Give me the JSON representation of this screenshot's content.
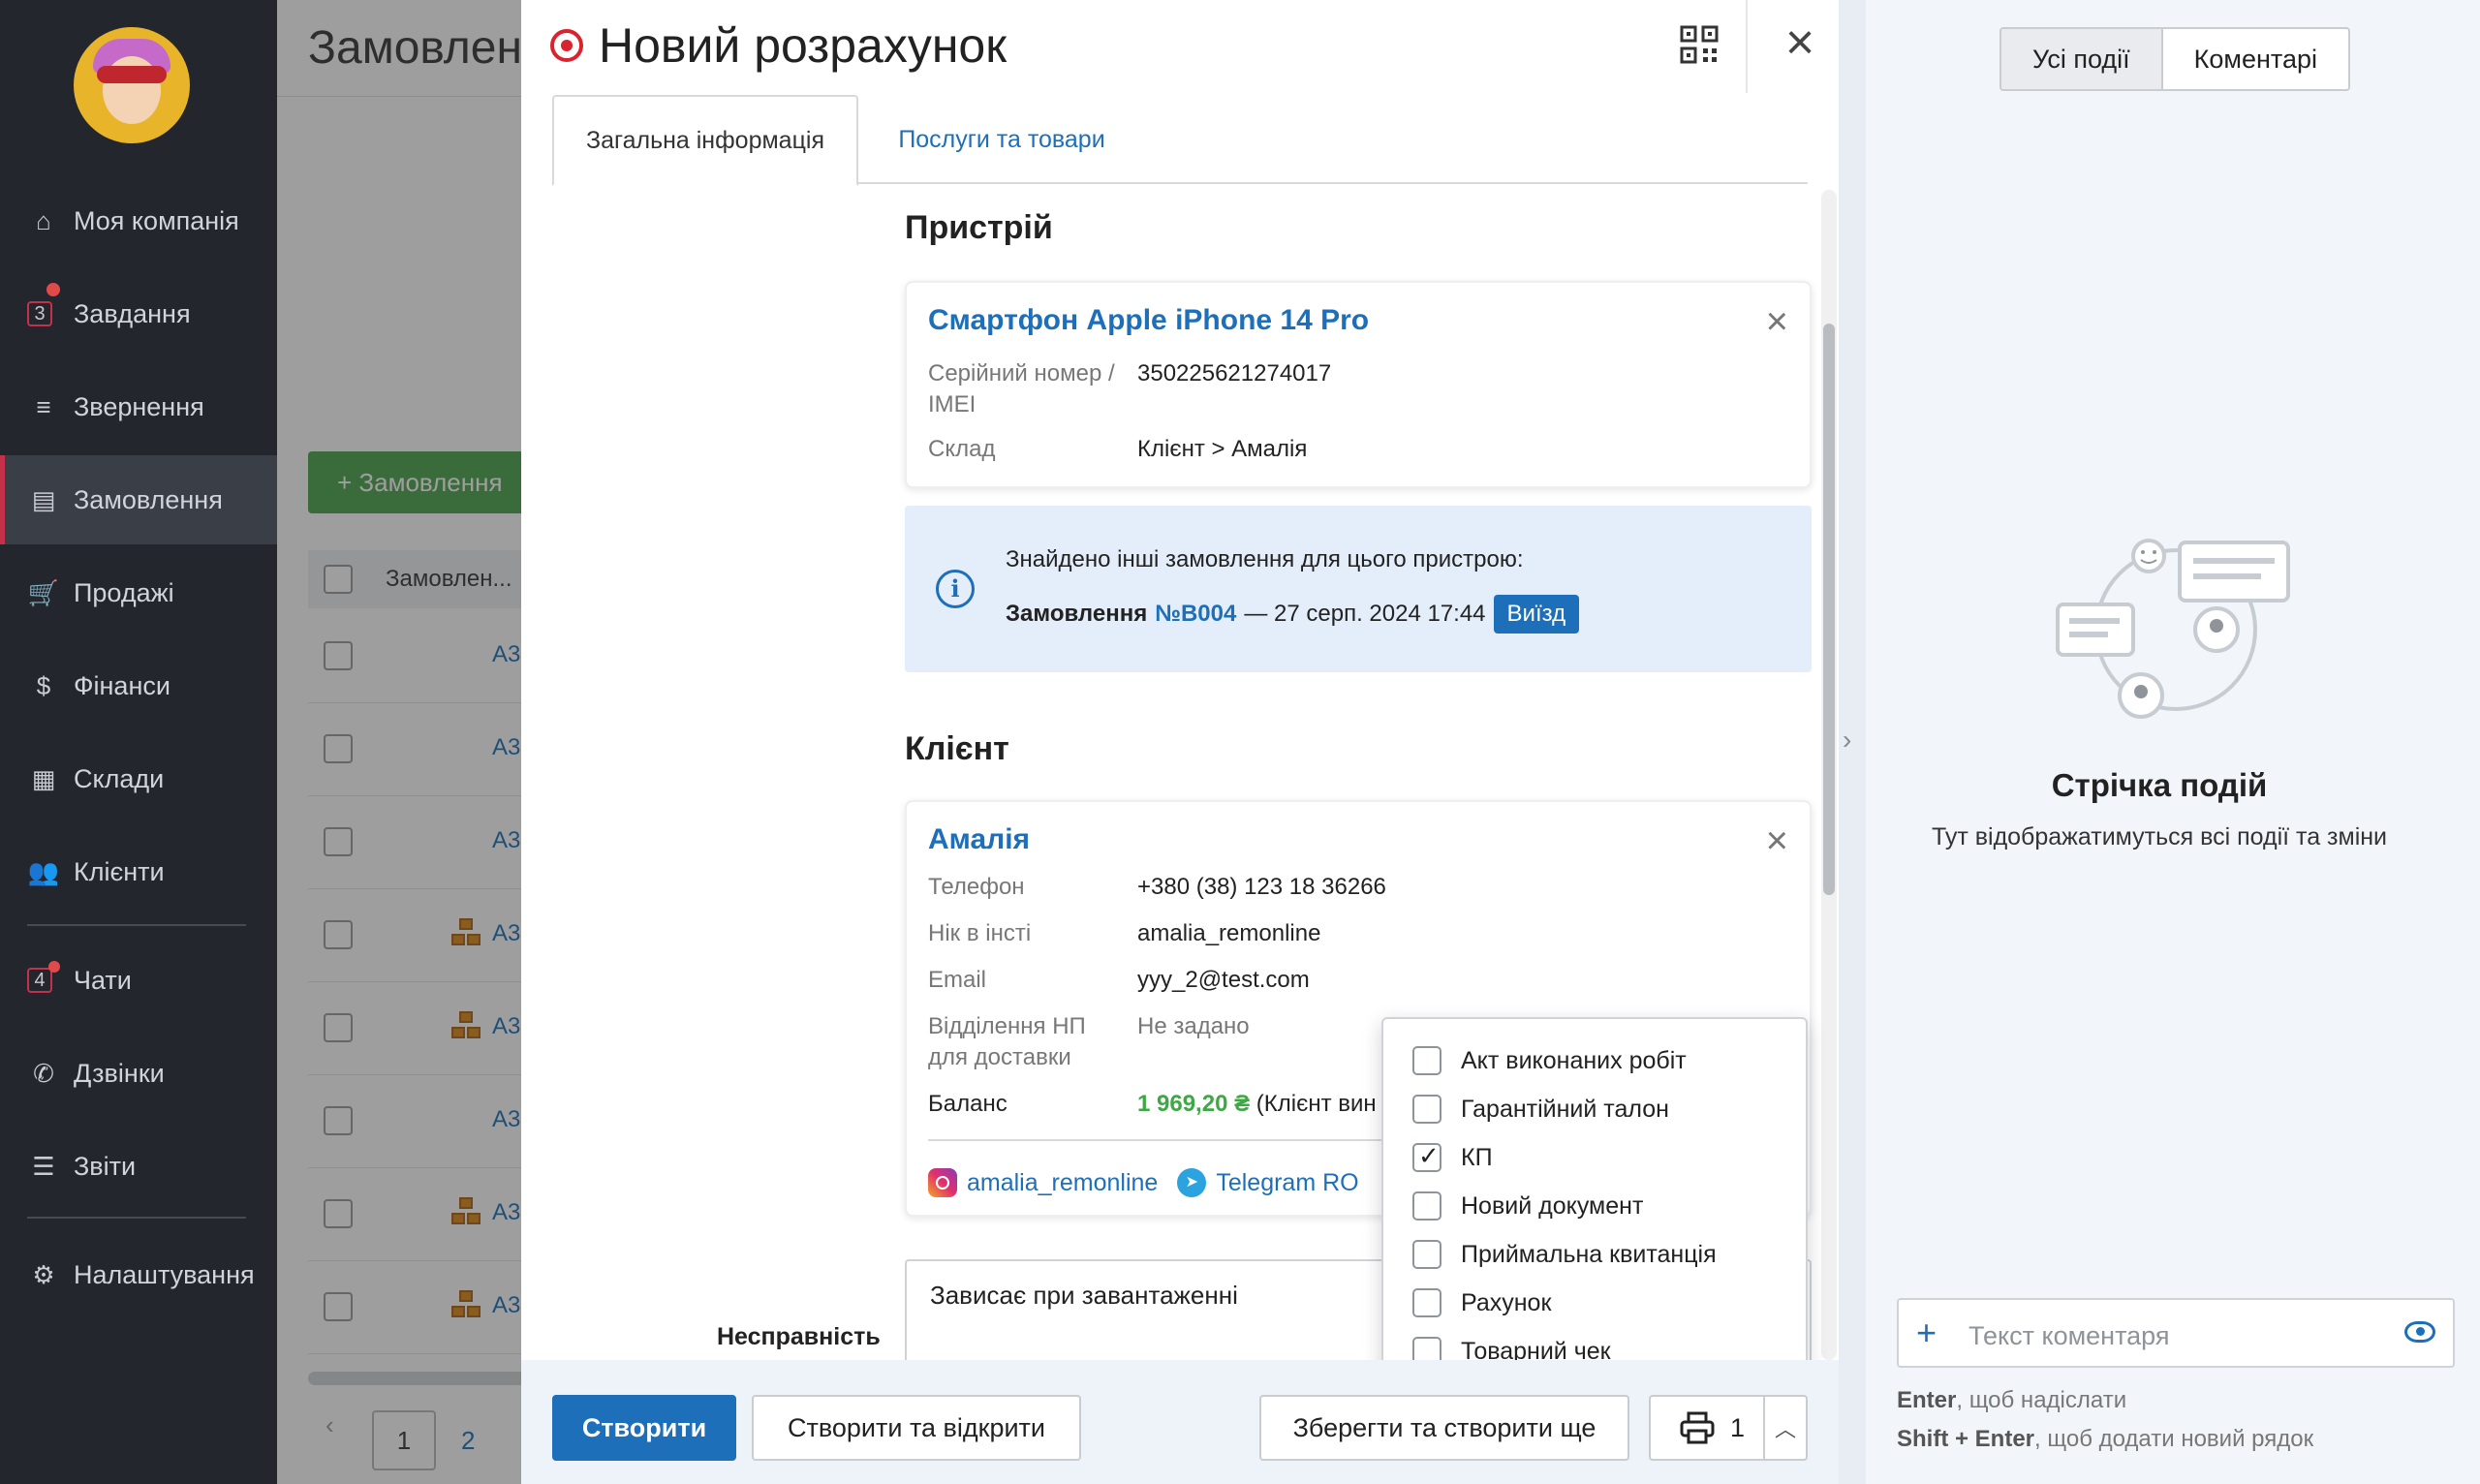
{
  "sidebar": {
    "items": [
      {
        "label": "Моя компанія",
        "icon": "home-icon"
      },
      {
        "label": "Завдання",
        "icon": "tasks-icon",
        "count": "3"
      },
      {
        "label": "Звернення",
        "icon": "filter-icon"
      },
      {
        "label": "Замовлення",
        "icon": "orders-icon"
      },
      {
        "label": "Продажі",
        "icon": "cart-icon"
      },
      {
        "label": "Фінанси",
        "icon": "dollar-icon"
      },
      {
        "label": "Склади",
        "icon": "warehouse-icon"
      },
      {
        "label": "Клієнти",
        "icon": "users-icon"
      },
      {
        "label": "Чати",
        "icon": "chat-icon",
        "count": "4"
      },
      {
        "label": "Дзвінки",
        "icon": "phone-icon"
      },
      {
        "label": "Звіти",
        "icon": "reports-icon"
      },
      {
        "label": "Налаштування",
        "icon": "gear-icon"
      }
    ]
  },
  "background": {
    "title": "Замовлен",
    "add_button": "+ Замовлення",
    "column_header": "Замовлен...",
    "row_link": "А3",
    "pages": [
      "1",
      "2"
    ]
  },
  "modal": {
    "title": "Новий розрахунок",
    "tabs": [
      "Загальна інформація",
      "Послуги та товари"
    ],
    "device_section": "Пристрій",
    "device": {
      "name": "Смартфон Apple iPhone 14 Pro",
      "serial_label": "Серійний номер / IMEI",
      "serial_value": "350225621274017",
      "warehouse_label": "Склад",
      "warehouse_value": "Клієнт > Амалія"
    },
    "notice": {
      "text": "Знайдено інші замовлення для цього пристрою:",
      "order_word": "Замовлення",
      "order_link": "№B004",
      "order_date": "— 27 серп. 2024 17:44",
      "badge": "Виїзд"
    },
    "client_section": "Клієнт",
    "client": {
      "name": "Амалія",
      "phone_label": "Телефон",
      "phone_value": "+380 (38) 123 18 36266",
      "insta_label": "Нік в інсті",
      "insta_value": "amalia_remonline",
      "email_label": "Email",
      "email_value": "yyy_2@test.com",
      "np_label": "Відділення НП для доставки",
      "np_value": "Не задано",
      "balance_label": "Баланс",
      "balance_value": "1 969,20 ₴",
      "balance_note": "(Клієнт вин",
      "link_instagram": "amalia_remonline",
      "link_telegram": "Telegram RO"
    },
    "issue_label": "Несправність",
    "issue_value": "Зависає при завантаженні",
    "print_options": [
      {
        "label": "Акт виконаних робіт",
        "checked": false
      },
      {
        "label": "Гарантійний талон",
        "checked": false
      },
      {
        "label": "КП",
        "checked": true
      },
      {
        "label": "Новий документ",
        "checked": false
      },
      {
        "label": "Приймальна квитанція",
        "checked": false
      },
      {
        "label": "Рахунок",
        "checked": false
      },
      {
        "label": "Товарний чек",
        "checked": false
      }
    ],
    "footer": {
      "create": "Створити",
      "create_open": "Створити та відкрити",
      "save_more": "Зберегти та створити ще",
      "print_count": "1"
    }
  },
  "events_panel": {
    "tabs": [
      "Усі події",
      "Коментарі"
    ],
    "empty_title": "Стрічка подій",
    "empty_subtitle": "Тут відображатимуться всі події та зміни",
    "comment_placeholder": "Текст коментаря",
    "hint_enter_key": "Enter",
    "hint_enter_text": ", щоб надіслати",
    "hint_shift_key": "Shift + Enter",
    "hint_shift_text": ", щоб додати новий рядок"
  }
}
